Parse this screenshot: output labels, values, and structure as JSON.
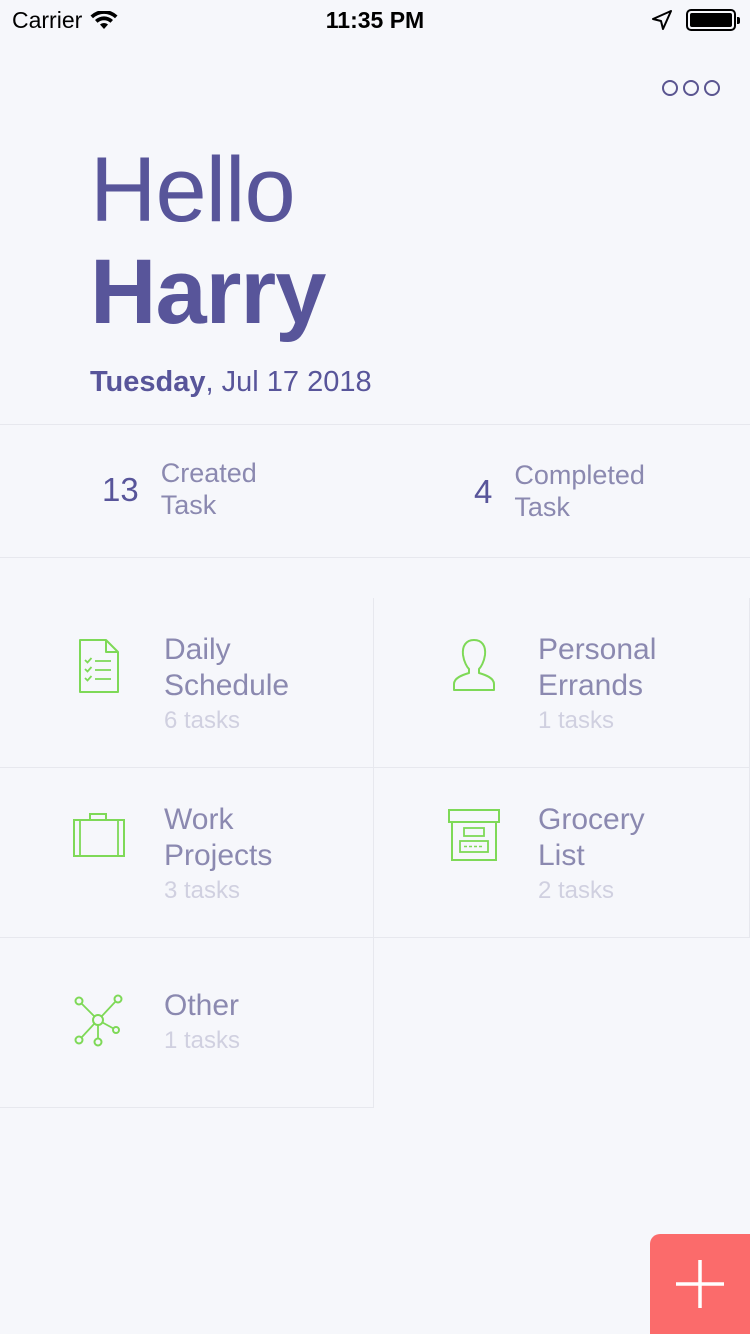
{
  "status_bar": {
    "carrier": "Carrier",
    "time": "11:35 PM",
    "icons": [
      "wifi-icon",
      "location-arrow-icon",
      "battery-icon"
    ]
  },
  "header": {
    "more_icon": "more-options-icon"
  },
  "greeting": {
    "hello": "Hello",
    "name": "Harry",
    "weekday": "Tuesday",
    "date_rest": ", Jul 17 2018"
  },
  "stats": {
    "created": {
      "count": "13",
      "label_line1": "Created",
      "label_line2": "Task"
    },
    "completed": {
      "count": "4",
      "label_line1": "Completed",
      "label_line2": "Task"
    }
  },
  "categories": [
    {
      "title_line1": "Daily",
      "title_line2": "Schedule",
      "subtitle": "6 tasks",
      "icon": "checklist-document-icon"
    },
    {
      "title_line1": "Personal",
      "title_line2": "Errands",
      "subtitle": "1 tasks",
      "icon": "person-icon"
    },
    {
      "title_line1": "Work",
      "title_line2": "Projects",
      "subtitle": "3 tasks",
      "icon": "briefcase-icon"
    },
    {
      "title_line1": "Grocery",
      "title_line2": "List",
      "subtitle": "2 tasks",
      "icon": "archive-box-icon"
    },
    {
      "title_line1": "Other",
      "title_line2": "",
      "subtitle": "1 tasks",
      "icon": "network-icon"
    }
  ],
  "fab": {
    "icon": "plus-icon"
  },
  "colors": {
    "background": "#f6f7fb",
    "primary_text": "#58559a",
    "secondary_text": "#8b89b0",
    "muted_text": "#d0d0e0",
    "icon_green": "#7ed957",
    "fab_red": "#fb6b6b"
  }
}
